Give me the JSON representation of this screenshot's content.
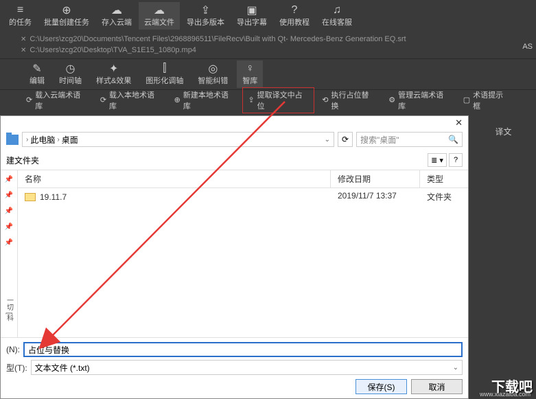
{
  "toolbar1": {
    "tasks": "的任务",
    "batch_create": "批量创建任务",
    "save_cloud": "存入云端",
    "cloud_files": "云端文件",
    "export_multi": "导出多版本",
    "export_subtitle": "导出字幕",
    "tutorial": "使用教程",
    "online_service": "在线客服"
  },
  "file_tabs": {
    "f1": "C:\\Users\\zcg20\\Documents\\Tencent Files\\2968896511\\FileRecv\\Built with Qt- Mercedes-Benz Generation EQ.srt",
    "f2": "C:\\Users\\zcg20\\Desktop\\TVA_S1E15_1080p.mp4"
  },
  "as_label": "AS",
  "toolbar2": {
    "edit": "编辑",
    "timeline": "时间轴",
    "style_fx": "样式&效果",
    "visual_adjust": "图形化调轴",
    "smart_correct": "智能纠错",
    "smart_lib": "智库"
  },
  "glossary": {
    "load_cloud": "载入云端术语库",
    "load_local": "载入本地术语库",
    "new_local": "新建本地术语库",
    "extract_placeholder": "提取译文中占位",
    "execute_replace": "执行占位替换",
    "manage_cloud": "管理云端术语库",
    "glossary_hint": "术语提示框"
  },
  "side": {
    "translate": "译文"
  },
  "dialog": {
    "breadcrumb": {
      "pc": "此电脑",
      "desktop": "桌面"
    },
    "search_placeholder": "搜索\"桌面\"",
    "new_folder": "建文件夹",
    "columns": {
      "name": "名称",
      "date": "修改日期",
      "type": "类型"
    },
    "items": [
      {
        "name": "19.11.7",
        "date": "2019/11/7 13:37",
        "type": "文件夹"
      }
    ],
    "quick_label": "一切 [科",
    "filename_label": "(N):",
    "filename_value": "占位与替换",
    "filetype_label": "型(T):",
    "filetype_value": "文本文件 (*.txt)",
    "save_btn": "保存(S)",
    "cancel_btn": "取消"
  },
  "watermark": {
    "main": "下载吧",
    "sub": "www.xiazaiba.com"
  }
}
